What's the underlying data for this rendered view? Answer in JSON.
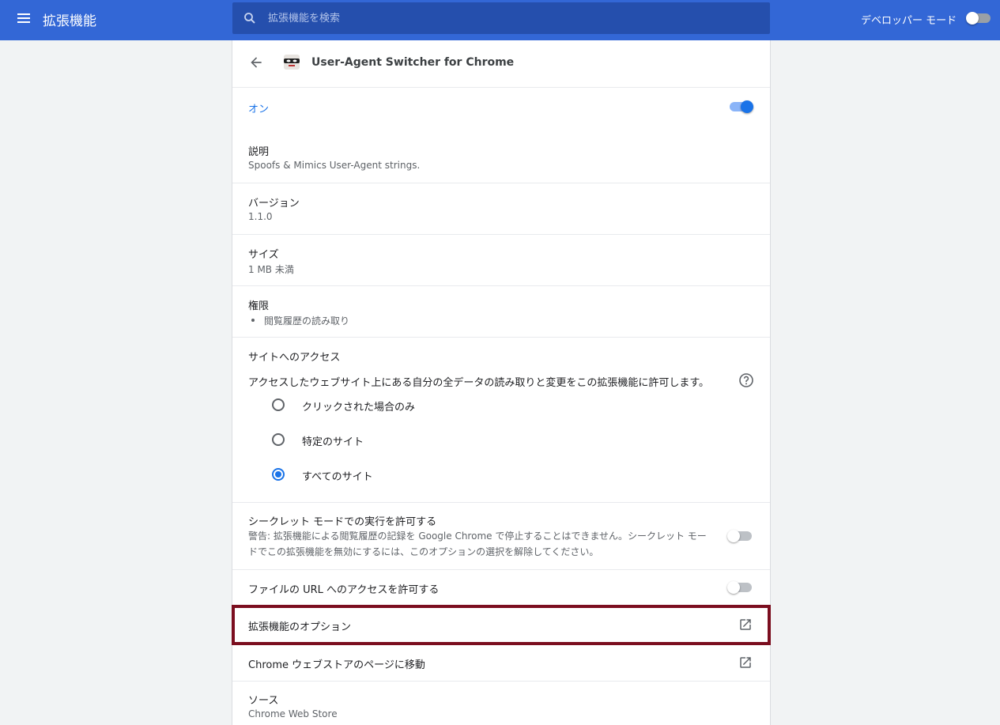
{
  "header": {
    "title": "拡張機能",
    "search_placeholder": "拡張機能を検索",
    "devmode_label": "デベロッパー モード",
    "devmode_on": false
  },
  "extension": {
    "name": "User-Agent Switcher for Chrome",
    "enabled_label": "オン",
    "enabled": true,
    "description_title": "説明",
    "description": "Spoofs & Mimics User-Agent strings.",
    "version_title": "バージョン",
    "version": "1.1.0",
    "size_title": "サイズ",
    "size": "1 MB 未満",
    "permissions_title": "権限",
    "permissions": [
      "閲覧履歴の読み取り"
    ],
    "site_access_title": "サイトへのアクセス",
    "site_access_desc": "アクセスしたウェブサイト上にある自分の全データの読み取りと変更をこの拡張機能に許可します。",
    "site_access_options": [
      {
        "label": "クリックされた場合のみ",
        "checked": false
      },
      {
        "label": "特定のサイト",
        "checked": false
      },
      {
        "label": "すべてのサイト",
        "checked": true
      }
    ],
    "incognito_title": "シークレット モードでの実行を許可する",
    "incognito_warning": "警告: 拡張機能による閲覧履歴の記録を Google Chrome で停止することはできません。シークレット モードでこの拡張機能を無効にするには、このオプションの選択を解除してください。",
    "incognito_on": false,
    "file_url_title": "ファイルの URL へのアクセスを許可する",
    "file_url_on": false,
    "options_label": "拡張機能のオプション",
    "webstore_label": "Chrome ウェブストアのページに移動",
    "source_title": "ソース",
    "source": "Chrome Web Store"
  },
  "colors": {
    "header_bg": "#3367d6",
    "accent": "#1a73e8",
    "highlight_border": "#7b0e1f"
  },
  "icons": [
    "menu-icon",
    "search-icon",
    "back-arrow-icon",
    "extension-mask-icon",
    "help-icon",
    "open-in-new-icon"
  ]
}
